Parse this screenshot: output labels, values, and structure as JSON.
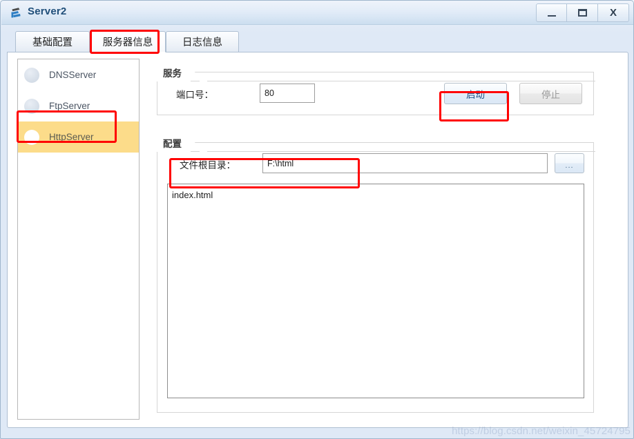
{
  "window": {
    "title": "Server2",
    "icon": "server-app-icon",
    "controls": {
      "minimize": "–",
      "maximize": "❐",
      "close": "X"
    }
  },
  "tabs": [
    {
      "label": "基础配置",
      "selected": false
    },
    {
      "label": "服务器信息",
      "selected": true
    },
    {
      "label": "日志信息",
      "selected": false
    }
  ],
  "sidebar": {
    "items": [
      {
        "label": "DNSServer",
        "selected": false
      },
      {
        "label": "FtpServer",
        "selected": false
      },
      {
        "label": "HttpServer",
        "selected": true
      }
    ]
  },
  "service_group": {
    "title": "服务",
    "port_label": "端口号：",
    "port_value": "80",
    "start_button": "启动",
    "stop_button": "停止"
  },
  "config_group": {
    "title": "配置",
    "root_dir_label": "文件根目录：",
    "root_dir_value": "F:\\html",
    "browse_button": "...",
    "files": [
      "index.html"
    ]
  },
  "watermark": "https://blog.csdn.net/weixin_45724795",
  "colors": {
    "accent": "#1c4f85",
    "selection": "#fcdc8a",
    "annotation": "#ff0000",
    "title_text": "#1f4e79"
  }
}
